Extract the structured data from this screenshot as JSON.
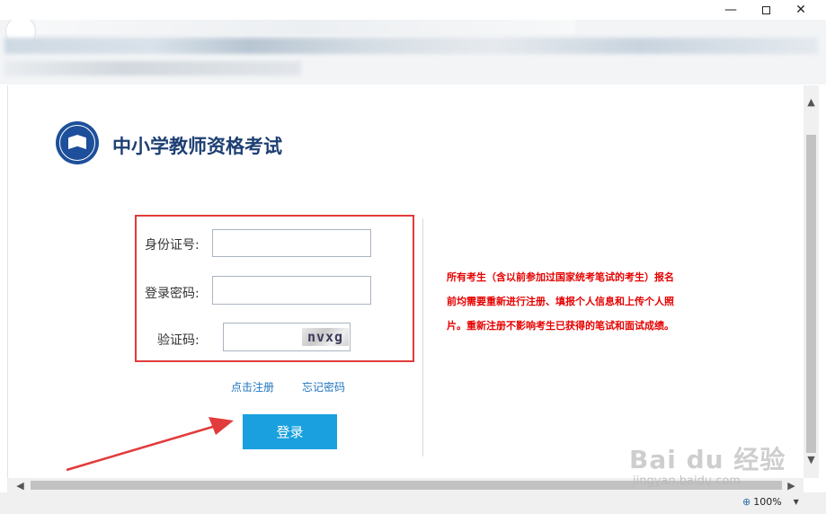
{
  "window": {
    "minimize_label": "—",
    "close_label": "✕"
  },
  "site": {
    "title": "中小学教师资格考试",
    "logo_icon": "teacher-exam-logo"
  },
  "form": {
    "id_label": "身份证号:",
    "id_value": "",
    "password_label": "登录密码:",
    "password_value": "",
    "captcha_label": "验证码:",
    "captcha_value": "",
    "captcha_image_text": "nvxg",
    "register_link": "点击注册",
    "forgot_link": "忘记密码",
    "login_button": "登录"
  },
  "notice": {
    "text": "所有考生（含以前参加过国家统考笔试的考生）报名前均需要重新进行注册、填报个人信息和上传个人照片。重新注册不影响考生已获得的笔试和面试成绩。"
  },
  "status": {
    "zoom": "100%"
  },
  "watermark": {
    "brand": "Bai du 经验",
    "url": "jingyan.baidu.com"
  },
  "colors": {
    "accent": "#1aa0de",
    "highlight_box": "#e23b3b",
    "notice_text": "#e60000",
    "title_text": "#1d3f73"
  }
}
